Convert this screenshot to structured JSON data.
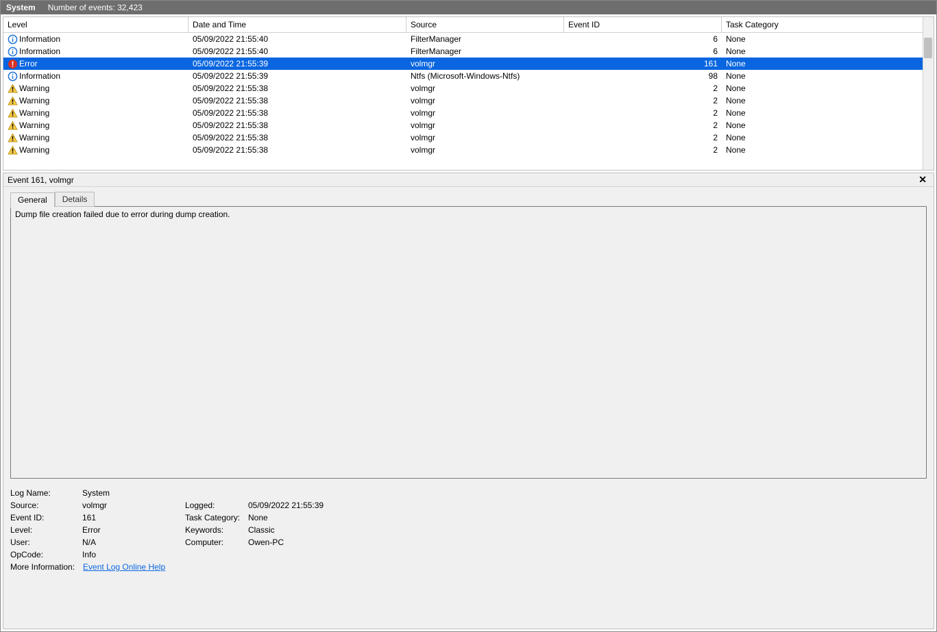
{
  "header": {
    "title": "System",
    "count_label": "Number of events: 32,423"
  },
  "columns": {
    "level": "Level",
    "datetime": "Date and Time",
    "source": "Source",
    "event_id": "Event ID",
    "task_category": "Task Category"
  },
  "events": [
    {
      "type": "info",
      "level": "Information",
      "datetime": "05/09/2022 21:55:40",
      "source": "FilterManager",
      "event_id": "6",
      "task": "None",
      "selected": false
    },
    {
      "type": "info",
      "level": "Information",
      "datetime": "05/09/2022 21:55:40",
      "source": "FilterManager",
      "event_id": "6",
      "task": "None",
      "selected": false
    },
    {
      "type": "error",
      "level": "Error",
      "datetime": "05/09/2022 21:55:39",
      "source": "volmgr",
      "event_id": "161",
      "task": "None",
      "selected": true
    },
    {
      "type": "info",
      "level": "Information",
      "datetime": "05/09/2022 21:55:39",
      "source": "Ntfs (Microsoft-Windows-Ntfs)",
      "event_id": "98",
      "task": "None",
      "selected": false
    },
    {
      "type": "warn",
      "level": "Warning",
      "datetime": "05/09/2022 21:55:38",
      "source": "volmgr",
      "event_id": "2",
      "task": "None",
      "selected": false
    },
    {
      "type": "warn",
      "level": "Warning",
      "datetime": "05/09/2022 21:55:38",
      "source": "volmgr",
      "event_id": "2",
      "task": "None",
      "selected": false
    },
    {
      "type": "warn",
      "level": "Warning",
      "datetime": "05/09/2022 21:55:38",
      "source": "volmgr",
      "event_id": "2",
      "task": "None",
      "selected": false
    },
    {
      "type": "warn",
      "level": "Warning",
      "datetime": "05/09/2022 21:55:38",
      "source": "volmgr",
      "event_id": "2",
      "task": "None",
      "selected": false
    },
    {
      "type": "warn",
      "level": "Warning",
      "datetime": "05/09/2022 21:55:38",
      "source": "volmgr",
      "event_id": "2",
      "task": "None",
      "selected": false
    },
    {
      "type": "warn",
      "level": "Warning",
      "datetime": "05/09/2022 21:55:38",
      "source": "volmgr",
      "event_id": "2",
      "task": "None",
      "selected": false
    }
  ],
  "detail": {
    "title": "Event 161, volmgr",
    "tabs": {
      "general": "General",
      "details": "Details"
    },
    "description": "Dump file creation failed due to error during dump creation.",
    "props": {
      "log_name_l": "Log Name:",
      "log_name_v": "System",
      "source_l": "Source:",
      "source_v": "volmgr",
      "logged_l": "Logged:",
      "logged_v": "05/09/2022 21:55:39",
      "event_id_l": "Event ID:",
      "event_id_v": "161",
      "taskcat_l": "Task Category:",
      "taskcat_v": "None",
      "level_l": "Level:",
      "level_v": "Error",
      "keywords_l": "Keywords:",
      "keywords_v": "Classic",
      "user_l": "User:",
      "user_v": "N/A",
      "computer_l": "Computer:",
      "computer_v": "Owen-PC",
      "opcode_l": "OpCode:",
      "opcode_v": "Info",
      "moreinfo_l": "More Information:",
      "moreinfo_link": "Event Log Online Help"
    }
  }
}
